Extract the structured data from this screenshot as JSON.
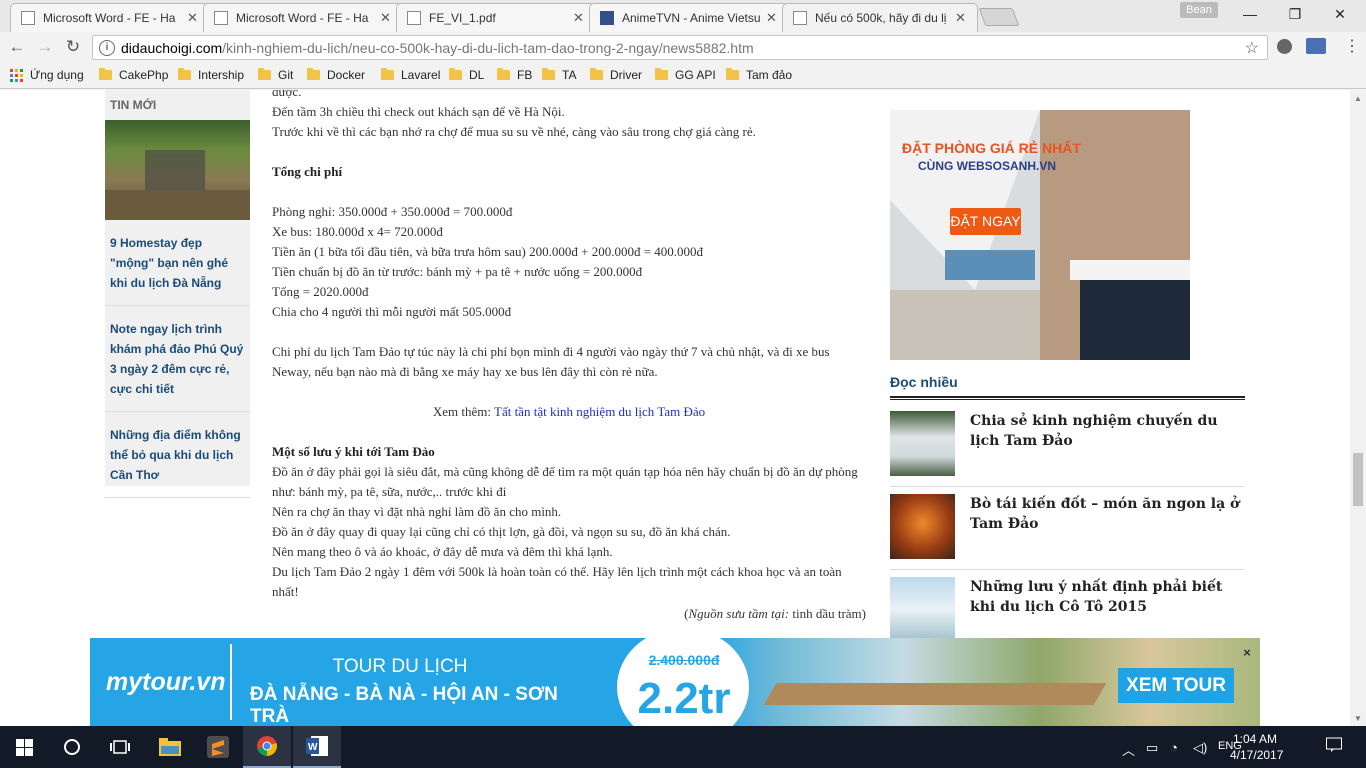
{
  "tabs": [
    {
      "label": "Microsoft Word - FE - Ha"
    },
    {
      "label": "Microsoft Word - FE - Ha"
    },
    {
      "label": "FE_VI_1.pdf"
    },
    {
      "label": "AnimeTVN - Anime Vietsu"
    },
    {
      "label": "Nếu có 500k, hãy đi du lị"
    }
  ],
  "profile_name": "Bean",
  "address": {
    "domain": "didauchoigi.com",
    "path": "/kinh-nghiem-du-lich/neu-co-500k-hay-di-du-lich-tam-dao-trong-2-ngay/news5882.htm"
  },
  "bookmarks": [
    "Ứng dụng",
    "CakePhp",
    "Intership",
    "Git",
    "Docker",
    "Lavarel",
    "DL",
    "FB",
    "TA",
    "Driver",
    "GG API",
    "Tam đảo"
  ],
  "sidebar": {
    "heading": "TIN MỚI",
    "items": [
      "9 Homestay đẹp \"mộng\" bạn nên ghé khi du lịch Đà Nẵng",
      "Note ngay lịch trình khám phá đảo Phú Quý 3 ngày 2 đêm cực rẻ, cực chi tiết",
      "Những địa điểm không thể bỏ qua khi du lịch Cần Thơ"
    ]
  },
  "article": {
    "line_top": "được.",
    "checkout": "Đến tầm 3h chiều thì check out khách sạn để về Hà Nội.",
    "market": "Trước khi về thì các bạn nhớ ra chợ để mua su su về nhé, càng vào sâu trong chợ giá càng rẻ.",
    "cost_heading": "Tổng chi phí",
    "costs": [
      "Phòng nghỉ: 350.000đ + 350.000đ = 700.000đ",
      "Xe bus: 180.000đ x 4= 720.000đ",
      "Tiền ăn (1 bữa tối đầu tiên, và bữa trưa hôm sau) 200.000đ + 200.000đ = 400.000đ",
      "Tiền chuẩn bị đồ ăn từ trước: bánh mỳ + pa tê + nước uống = 200.000đ",
      "Tổng = 2020.000đ",
      "Chia cho 4 người thì mỗi người mất 505.000đ"
    ],
    "summary": "Chi phí du lịch Tam Đảo tự túc này là chi phí bọn mình đi 4 người vào ngày thứ 7 và chủ nhật, và đi xe bus Neway, nếu bạn nào mà đi bằng xe máy hay xe bus lên đây thì còn rẻ nữa.",
    "see_more_prefix": "Xem thêm: ",
    "see_more_link": "Tất tần tật kinh nghiệm du lịch Tam Đảo",
    "notes_heading": "Một số lưu ý khi tới Tam Đảo",
    "notes": [
      "Đồ ăn ở đây phải gọi là siêu đắt, mà cũng không dễ để tìm ra một quán tạp hóa nên hãy chuẩn bị đồ ăn dự phòng như: bánh mỳ, pa tê, sữa, nước,.. trước khi đi",
      "Nên ra chợ ăn thay vì đặt nhà nghỉ làm đồ ăn cho mình.",
      "Đồ ăn ở đây quay đi quay lại cũng chỉ có thịt lợn, gà đồi, và ngọn su su, đồ ăn khá chán.",
      "Nên mang theo ô và áo khoác, ở đây dễ mưa và đêm thì khá lạnh.",
      "Du lịch Tam Đảo 2 ngày 1 đêm với 500k là hoàn toàn có thể. Hãy lên lịch trình một cách khoa học và an toàn nhất!"
    ],
    "source_label": "Nguồn sưu tầm tại:",
    "source_value": " tinh dầu tràm)",
    "source_open": "("
  },
  "ad": {
    "title": "ĐẶT PHÒNG GIÁ RẺ NHẤT",
    "subtitle": "CÙNG WEBSOSANH.VN",
    "button": "ĐẶT NGAY"
  },
  "popular": {
    "heading": "Đọc nhiều",
    "items": [
      "Chia sẻ kinh nghiệm chuyến du lịch Tam Đảo",
      "Bò tái kiến đốt – món ăn ngon lạ ở Tam Đảo",
      "Những lưu ý nhất định phải biết khi du lịch Cô Tô 2015"
    ]
  },
  "banner": {
    "logo": "mytour.vn",
    "line1": "TOUR DU LỊCH",
    "line2": "ĐÀ NẴNG - BÀ NÀ - HỘI AN - SƠN TRÀ",
    "old_price": "2.400.000đ",
    "price": "2.2tr",
    "button": "XEM TOUR",
    "close": "×"
  },
  "taskbar": {
    "lang": "ENG",
    "time": "1:04 AM",
    "date": "4/17/2017"
  }
}
